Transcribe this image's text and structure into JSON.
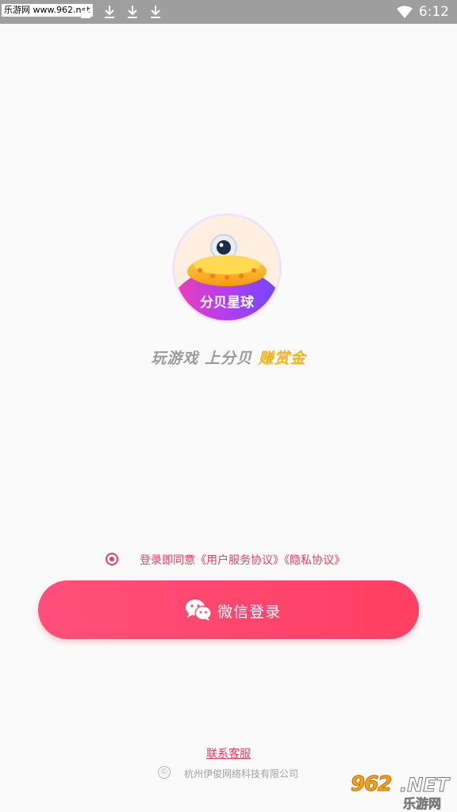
{
  "status_bar": {
    "watermark": "乐游网 www.962.net",
    "time": "6:12",
    "icons": [
      "download-icon",
      "download-icon",
      "download-icon",
      "download-icon",
      "wifi-icon"
    ]
  },
  "logo": {
    "text": "分贝星球"
  },
  "tagline": {
    "part1": "玩游戏 上分贝 ",
    "part2": "赚赏金"
  },
  "agreement": {
    "prefix": "登录即同意",
    "user_agreement": "《用户服务协议》",
    "privacy_policy": "《隐私协议》",
    "checked": true
  },
  "login_button": {
    "label": "微信登录",
    "icon": "wechat-icon"
  },
  "footer": {
    "contact": "联系客服",
    "copyright_symbol": "©",
    "company": "杭州伊俊网络科技有限公司"
  },
  "corner_watermark": {
    "number": "962",
    "domain": ".NET",
    "cn": "乐游网"
  },
  "colors": {
    "accent": "#ff4568",
    "gold": "#f2b21b",
    "status_bar": "#9e9e9e"
  }
}
